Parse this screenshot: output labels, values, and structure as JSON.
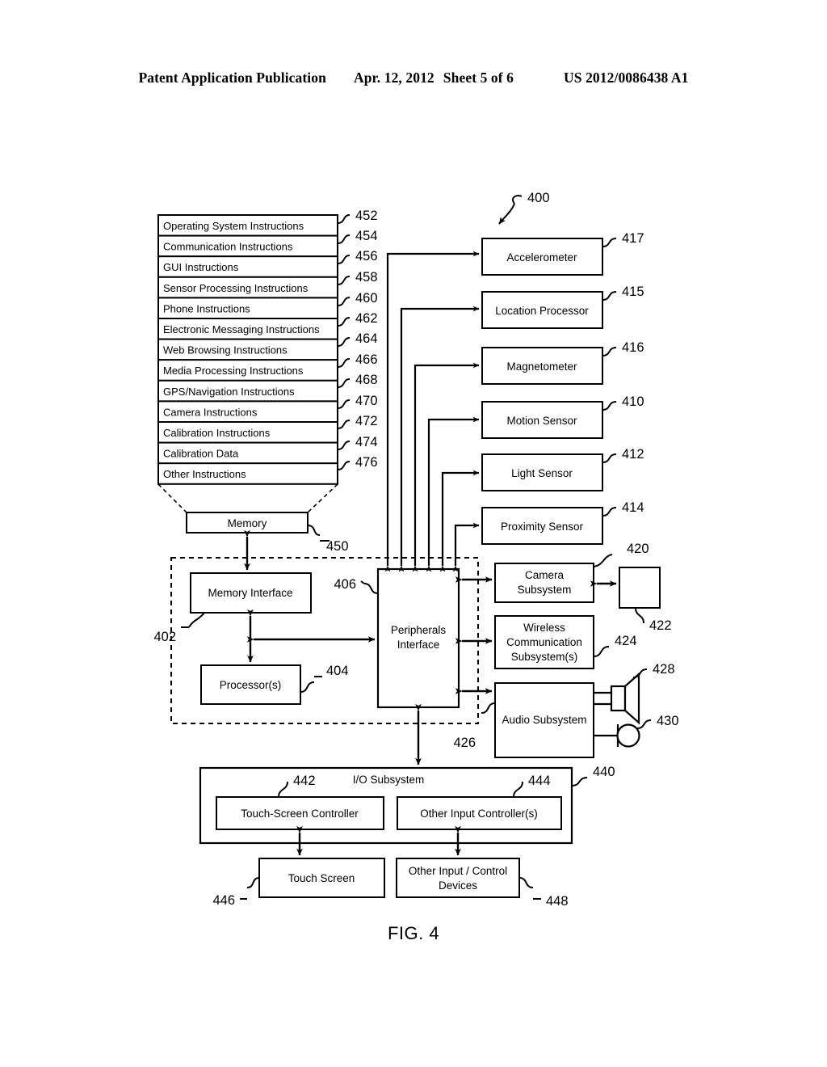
{
  "header": {
    "publication": "Patent Application Publication",
    "date": "Apr. 12, 2012",
    "sheet": "Sheet 5 of 6",
    "number": "US 2012/0086438 A1"
  },
  "figure": {
    "caption": "FIG. 4",
    "system_ref": "400"
  },
  "memory": {
    "label": "Memory",
    "ref": "450",
    "instructions": [
      {
        "label": "Operating System Instructions",
        "ref": "452"
      },
      {
        "label": "Communication Instructions",
        "ref": "454"
      },
      {
        "label": "GUI Instructions",
        "ref": "456"
      },
      {
        "label": "Sensor Processing Instructions",
        "ref": "458"
      },
      {
        "label": "Phone Instructions",
        "ref": "460"
      },
      {
        "label": "Electronic Messaging Instructions",
        "ref": "462"
      },
      {
        "label": "Web Browsing Instructions",
        "ref": "464"
      },
      {
        "label": "Media Processing Instructions",
        "ref": "466"
      },
      {
        "label": "GPS/Navigation Instructions",
        "ref": "468"
      },
      {
        "label": "Camera Instructions",
        "ref": "470"
      },
      {
        "label": "Calibration Instructions",
        "ref": "472"
      },
      {
        "label": "Calibration Data",
        "ref": "474"
      },
      {
        "label": "Other Instructions",
        "ref": "476"
      }
    ]
  },
  "core": {
    "memory_interface": {
      "label": "Memory Interface",
      "ref": "402"
    },
    "processors": {
      "label": "Processor(s)",
      "ref": "404"
    },
    "peripherals_interface": {
      "label_line1": "Peripherals",
      "label_line2": "Interface",
      "ref": "406"
    }
  },
  "sensors": [
    {
      "label": "Accelerometer",
      "ref": "417"
    },
    {
      "label": "Location Processor",
      "ref": "415"
    },
    {
      "label": "Magnetometer",
      "ref": "416"
    },
    {
      "label": "Motion Sensor",
      "ref": "410"
    },
    {
      "label": "Light Sensor",
      "ref": "412"
    },
    {
      "label": "Proximity Sensor",
      "ref": "414"
    }
  ],
  "subsystems": {
    "camera": {
      "label_line1": "Camera",
      "label_line2": "Subsystem",
      "ref": "420"
    },
    "optical_device": {
      "label": "",
      "ref": "422"
    },
    "wireless": {
      "label_line1": "Wireless",
      "label_line2": "Communication",
      "label_line3": "Subsystem(s)",
      "ref": "424"
    },
    "audio": {
      "label": "Audio Subsystem",
      "ref": "426"
    },
    "speaker": {
      "ref": "428"
    },
    "microphone": {
      "ref": "430"
    }
  },
  "io_subsystem": {
    "label": "I/O Subsystem",
    "ref": "440",
    "touch_screen_controller": {
      "label": "Touch-Screen Controller",
      "ref": "442"
    },
    "other_input_controller": {
      "label": "Other Input Controller(s)",
      "ref": "444"
    },
    "touch_screen": {
      "label": "Touch Screen",
      "ref": "446"
    },
    "other_input_devices": {
      "label_line1": "Other Input / Control",
      "label_line2": "Devices",
      "ref": "448"
    }
  },
  "colors": {
    "ink": "#000000",
    "paper": "#ffffff"
  }
}
